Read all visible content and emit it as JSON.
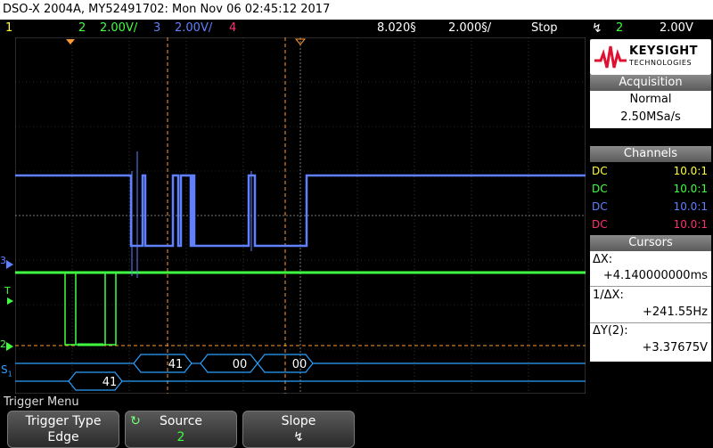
{
  "title_bar": "DSO-X 2004A, MY52491702: Mon Nov 06 02:45:12 2017",
  "status": {
    "ch1_num": "1",
    "ch2_num": "2",
    "ch2_scale": "2.00V/",
    "ch3_num": "3",
    "ch3_scale": "2.00V/",
    "ch4_num": "4",
    "time_pos": "8.020§",
    "time_scale": "2.000§/",
    "run_state": "Stop",
    "trig_channel": "2",
    "trig_level": "2.00V"
  },
  "logo": {
    "line1": "KEYSIGHT",
    "line2": "TECHNOLOGIES"
  },
  "acquisition": {
    "header": "Acquisition",
    "mode": "Normal",
    "rate": "2.50MSa/s"
  },
  "channels": {
    "header": "Channels",
    "rows": [
      {
        "coupling": "DC",
        "probe": "10.0:1",
        "color": "#ffff40"
      },
      {
        "coupling": "DC",
        "probe": "10.0:1",
        "color": "#40ff40"
      },
      {
        "coupling": "DC",
        "probe": "10.0:1",
        "color": "#6080ff"
      },
      {
        "coupling": "DC",
        "probe": "10.0:1",
        "color": "#ff3070"
      }
    ]
  },
  "cursors": {
    "header": "Cursors",
    "dx_label": "ΔX:",
    "dx_value": "+4.140000000ms",
    "inv_dx_label": "1/ΔX:",
    "inv_dx_value": "+241.55Hz",
    "dy_label": "ΔY(2):",
    "dy_value": "+3.37675V"
  },
  "waveform_labels": {
    "ch3_marker": "3",
    "trig_marker": "T",
    "ch2_marker": "2",
    "serial_marker": "S",
    "serial_sub": "1",
    "decode_bytes": [
      "41",
      "00",
      "00"
    ],
    "decode_lower": "41"
  },
  "menu": {
    "title": "Trigger Menu",
    "softkeys": [
      {
        "label": "Trigger Type",
        "value": "Edge"
      },
      {
        "label": "Source",
        "value": "2"
      },
      {
        "label": "Slope",
        "value": "↯"
      }
    ]
  },
  "colors": {
    "ch1": "#ffff40",
    "ch2": "#40ff40",
    "ch3": "#6080ff",
    "ch4": "#ff3070",
    "cursor": "#ff9933",
    "decode": "#2aa0ff"
  }
}
